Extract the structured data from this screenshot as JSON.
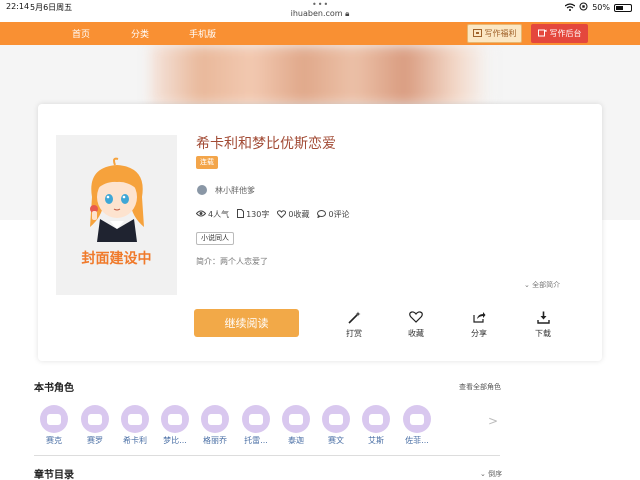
{
  "status": {
    "time": "22:14",
    "date": "5月6日周五",
    "url": "ihuaben.com",
    "battery": "50%"
  },
  "nav": {
    "items": [
      "首页",
      "分类",
      "手机版"
    ],
    "welfare_btn": "写作福利",
    "backend_btn": "写作后台"
  },
  "cover": {
    "text": "封面建设中"
  },
  "book": {
    "title": "希卡利和梦比优斯恋爱",
    "status_tag": "连载",
    "author": "林小胖他爹",
    "stats": {
      "popularity": "4人气",
      "words": "130字",
      "favorites": "0收藏",
      "comments": "0评论"
    },
    "category": "小说同人",
    "intro": "简介：两个人恋爱了",
    "all_intro": "全部简介",
    "read_btn": "继续阅读",
    "actions": [
      "打赏",
      "收藏",
      "分享",
      "下载"
    ]
  },
  "roles": {
    "title": "本书角色",
    "see_all": "查看全部角色",
    "items": [
      "赛克",
      "赛罗",
      "希卡利",
      "梦比...",
      "格丽乔",
      "托雷...",
      "泰迦",
      "赛文",
      "艾斯",
      "佐菲..."
    ],
    "next": ">"
  },
  "chapters": {
    "title": "章节目录",
    "sort": "倒序"
  },
  "colors": {
    "brand": "#f99033",
    "accent": "#f2a948",
    "red": "#e4473d"
  }
}
